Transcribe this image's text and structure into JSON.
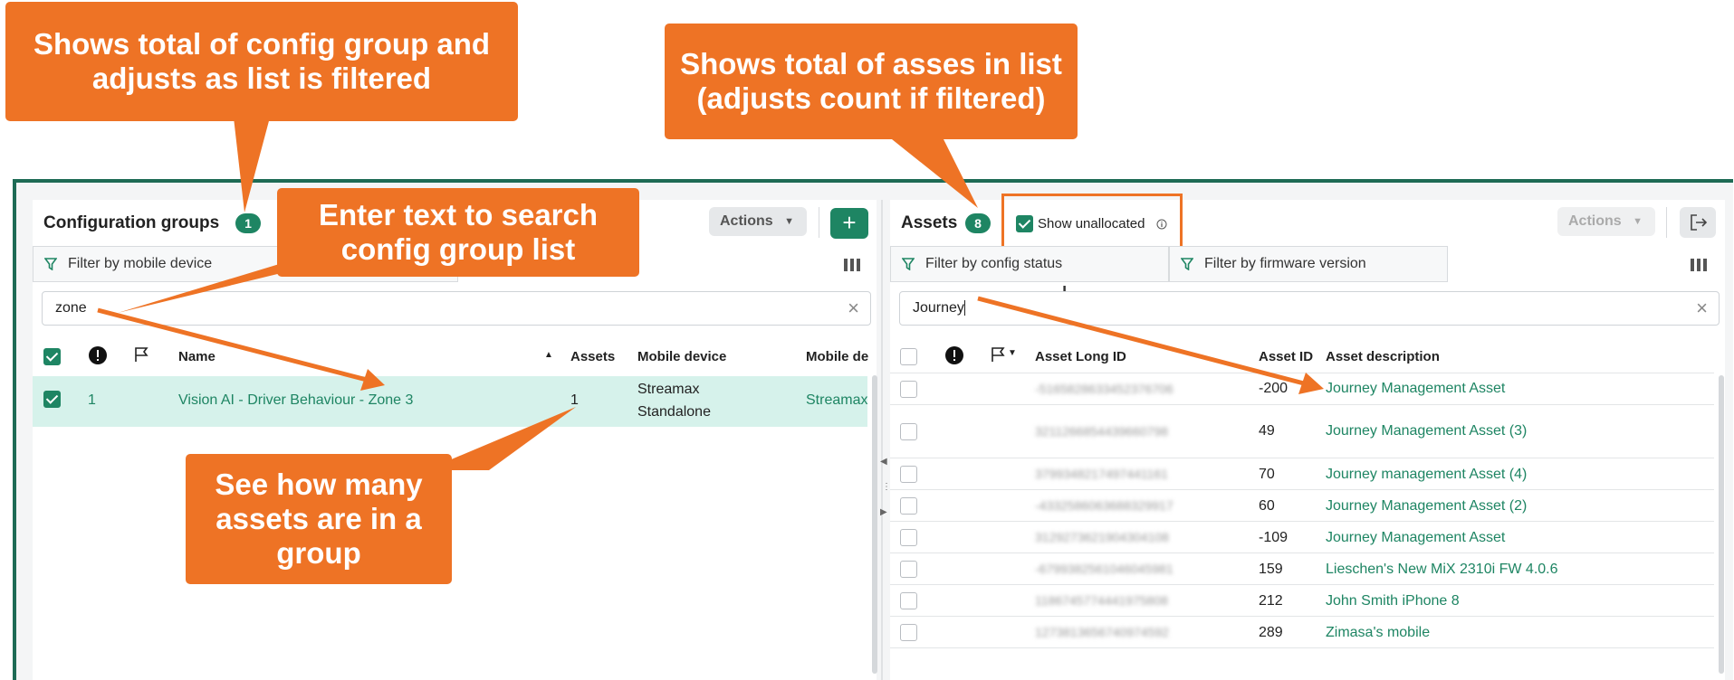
{
  "annotations": {
    "callout_config_total": "Shows total of config group and adjusts as list is filtered",
    "callout_assets_total": "Shows total of asses in list (adjusts count if filtered)",
    "callout_search": "Enter text to search config group list",
    "callout_assets_in_group": "See how many assets are in a group"
  },
  "left_panel": {
    "title": "Configuration groups",
    "count": "1",
    "actions_label": "Actions",
    "add_label": "+",
    "filter_label": "Filter by mobile device",
    "search_value": "zone",
    "columns": [
      "Name",
      "Assets",
      "Mobile device",
      "Mobile de"
    ],
    "rows": [
      {
        "id": "1",
        "name": "Vision AI - Driver Behaviour - Zone 3",
        "assets": "1",
        "device_line1": "Streamax",
        "device_line2": "Standalone",
        "device2": "Streamax"
      }
    ]
  },
  "right_panel": {
    "title": "Assets",
    "count": "8",
    "show_unallocated": "Show unallocated",
    "actions_label": "Actions",
    "filter_config": "Filter by config status",
    "filter_firmware": "Filter by firmware version",
    "search_value": "Journey",
    "columns": [
      "Asset Long ID",
      "Asset ID",
      "Asset description"
    ],
    "rows": [
      {
        "long_id": "-5165828633452376706",
        "asset_id": "-200",
        "desc": "Journey Management Asset"
      },
      {
        "long_id": "3211266854439660798",
        "asset_id": "49",
        "desc": "Journey Management Asset (3)"
      },
      {
        "long_id": "3799348217497441161",
        "asset_id": "70",
        "desc": "Journey management Asset (4)"
      },
      {
        "long_id": "-4332586063688329917",
        "asset_id": "60",
        "desc": "Journey Management Asset (2)"
      },
      {
        "long_id": "3129273621904304108",
        "asset_id": "-109",
        "desc": "Journey Management Asset"
      },
      {
        "long_id": "-6799382561046045981",
        "asset_id": "159",
        "desc": "Lieschen's New MiX 2310i FW 4.0.6"
      },
      {
        "long_id": "1186745774441975808",
        "asset_id": "212",
        "desc": "John Smith iPhone 8"
      },
      {
        "long_id": "1273813656740974592",
        "asset_id": "289",
        "desc": "Zimasa's mobile"
      }
    ]
  },
  "colors": {
    "accent": "#1e8563",
    "callout": "#ee7325",
    "frame": "#1e6b55"
  }
}
